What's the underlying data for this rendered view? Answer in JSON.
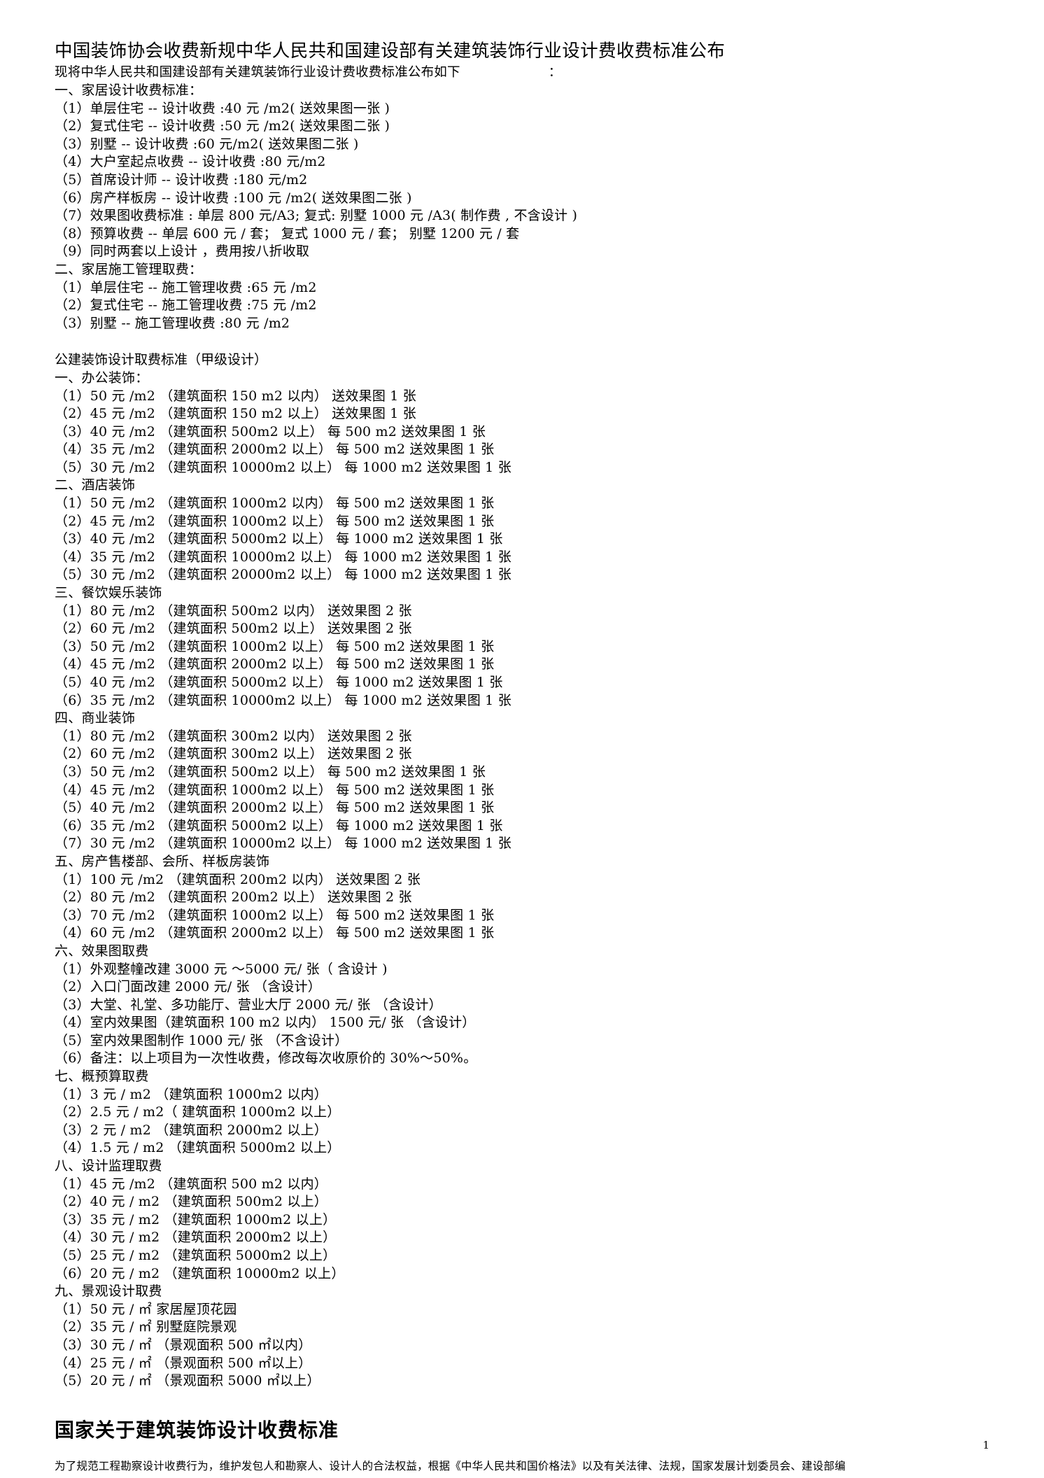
{
  "document": {
    "title": "中国装饰协会收费新规中华人民共和国建设部有关建筑装饰行业设计费收费标准公布",
    "lead": "现将中华人民共和国建设部有关建筑装饰行业设计费收费标准公布如下",
    "lead_colon": "：",
    "page_number": "1"
  },
  "home_design": {
    "heading": "一、家居设计收费标准：",
    "items": [
      "（1）单层住宅 -- 设计收费 :40  元 /m2( 送效果图一张  )",
      "（2）复式住宅 -- 设计收费 :50  元 /m2( 送效果图二张  )",
      "（3）别墅 -- 设计收费 :60  元/m2( 送效果图二张  )",
      "（4）大户室起点收费  -- 设计收费 :80  元/m2",
      "（5）首席设计师 -- 设计收费 :180  元/m2",
      "（6）房产样板房 -- 设计收费 :100  元 /m2( 送效果图二张  )",
      "（7）效果图收费标准 : 单层 800 元/A3;   复式:  别墅 1000 元 /A3( 制作费 , 不含设计  )",
      "（8）预算收费 -- 单层 600 元 / 套；  复式 1000 元 / 套； 别墅 1200 元 / 套",
      "（9）同时两套以上设计  ，费用按八折收取"
    ]
  },
  "home_construction": {
    "heading": "二、家居施工管理取费：",
    "items": [
      "（1）单层住宅 -- 施工管理收费 :65  元 /m2",
      "（2）复式住宅 -- 施工管理收费 :75  元 /m2",
      "（3）别墅 -- 施工管理收费 :80  元 /m2"
    ]
  },
  "public_section": {
    "heading": "公建装饰设计取费标准（甲级设计）",
    "groups": [
      {
        "heading": "一、办公装饰：",
        "items": [
          "（1）50 元 /m2  （建筑面积  150 m2 以内）   送效果图  1 张",
          "（2）45 元 /m2  （建筑面积  150 m2 以上）   送效果图  1 张",
          "（3）40 元 /m2  （建筑面积  500m2 以上）  每 500 m2 送效果图  1 张",
          "（4）35 元 /m2  （建筑面积  2000m2 以上）  每 500 m2 送效果图  1 张",
          "（5）30 元 /m2  （建筑面积  10000m2 以上）  每 1000 m2 送效果图  1 张"
        ]
      },
      {
        "heading": "二、酒店装饰",
        "items": [
          "（1）50 元 /m2  （建筑面积  1000m2 以内）  每 500 m2 送效果图  1 张",
          "（2）45 元 /m2  （建筑面积  1000m2 以上）  每 500 m2 送效果图  1 张",
          "（3）40 元 /m2  （建筑面积  5000m2 以上）  每 1000 m2 送效果图  1 张",
          "（4）35 元 /m2  （建筑面积  10000m2 以上）  每 1000 m2 送效果图  1 张",
          "（5）30 元 /m2  （建筑面积  20000m2 以上）  每 1000 m2 送效果图  1 张"
        ]
      },
      {
        "heading": "三、餐饮娱乐装饰",
        "items": [
          "（1）80 元 /m2  （建筑面积  500m2 以内）   送效果图  2 张",
          "（2）60 元 /m2  （建筑面积  500m2 以上）   送效果图  2 张",
          "（3）50 元 /m2  （建筑面积  1000m2 以上）  每 500 m2 送效果图  1 张",
          "（4）45 元 /m2  （建筑面积  2000m2 以上）  每 500 m2 送效果图  1 张",
          "（5）40 元 /m2  （建筑面积  5000m2 以上）  每 1000 m2 送效果图  1 张",
          "（6）35 元 /m2  （建筑面积  10000m2 以上）  每 1000 m2 送效果图  1 张"
        ]
      },
      {
        "heading": "四、商业装饰",
        "items": [
          "（1）80 元 /m2  （建筑面积  300m2 以内）   送效果图  2 张",
          "（2）60 元 /m2  （建筑面积  300m2 以上）   送效果图  2 张",
          "（3）50 元 /m2  （建筑面积  500m2 以上）  每 500 m2 送效果图  1 张",
          "（4）45 元 /m2  （建筑面积  1000m2 以上）  每 500 m2 送效果图  1 张",
          "（5）40 元 /m2  （建筑面积  2000m2 以上）  每 500 m2 送效果图  1 张",
          "（6）35 元 /m2  （建筑面积  5000m2 以上）  每 1000 m2 送效果图  1 张",
          "（7）30 元 /m2  （建筑面积  10000m2 以上）  每 1000 m2 送效果图  1 张"
        ]
      },
      {
        "heading": "五、房产售楼部、会所、样板房装饰",
        "items": [
          "（1）100 元 /m2  （建筑面积  200m2 以内）   送效果图  2 张",
          "（2）80 元 /m2  （建筑面积  200m2 以上）   送效果图  2 张",
          "（3）70 元 /m2  （建筑面积  1000m2 以上）  每 500 m2 送效果图  1 张",
          "（4）60 元 /m2  （建筑面积  2000m2 以上）  每 500 m2 送效果图  1 张"
        ]
      },
      {
        "heading": "六、效果图取费",
        "items": [
          "（1）外观整幢改建  3000  元 ～5000 元/ 张（ 含设计 )",
          "（2）入口门面改建  2000  元/ 张  （含设计）",
          "（3）大堂、礼堂、多功能厅、营业大厅     2000  元/ 张  （含设计）",
          "（4）室内效果图（建筑面积    100 m2 以内） 1500  元/ 张  （含设计）",
          "（5）室内效果图制作  1000  元/ 张  （不含设计）",
          "（6）备注：以上项目为一次性收费，修改每次收原价的       30%～50%。"
        ]
      },
      {
        "heading": "七、概预算取费",
        "items": [
          "（1）3 元 / m2  （建筑面积  1000m2 以内）",
          "（2）2.5  元 / m2（ 建筑面积  1000m2 以上）",
          "（3）2 元 / m2  （建筑面积  2000m2 以上）",
          "（4）1.5  元 / m2  （建筑面积  5000m2 以上）"
        ]
      },
      {
        "heading": "八、设计监理取费",
        "items": [
          "（1）45 元 /m2  （建筑面积  500 m2 以内）",
          "（2）40 元 / m2  （建筑面积  500m2 以上）",
          "（3）35 元 / m2  （建筑面积  1000m2 以上）",
          "（4）30 元 / m2  （建筑面积  2000m2 以上）",
          "（5）25 元 / m2  （建筑面积  5000m2 以上）",
          "（6）20 元 / m2  （建筑面积  10000m2 以上）"
        ]
      },
      {
        "heading": "九、景观设计取费",
        "items": [
          "（1）50 元 / ㎡  家居屋顶花园",
          "（2）35 元 / ㎡  别墅庭院景观",
          "（3）30 元 / ㎡  （景观面积  500 ㎡以内）",
          "（4）25 元 / ㎡  （景观面积  500 ㎡以上）",
          "（5）20 元 / ㎡  （景观面积  5000 ㎡以上）"
        ]
      }
    ]
  },
  "national_standard": {
    "heading": "国家关于建筑装饰设计收费标准",
    "paragraph": "为了规范工程勘察设计收费行为，维护发包人和勘察人、设计人的合法权益，根据《中华人民共和国价格法》以及有关法律、法规，国家发展计划委员会、建设部编"
  }
}
